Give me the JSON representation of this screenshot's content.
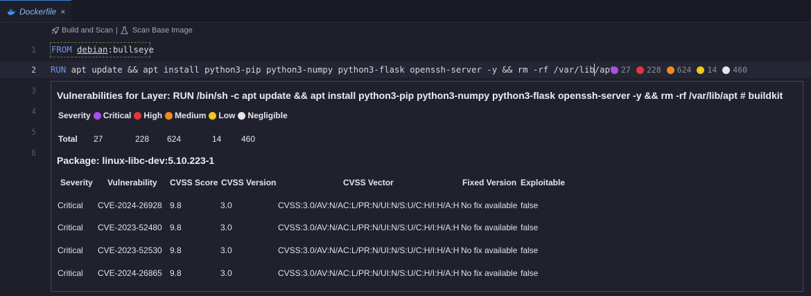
{
  "tab": {
    "label": "Dockerfile",
    "close": "×"
  },
  "codelens": {
    "build_scan": "Build and Scan",
    "separator": "|",
    "scan_base": "Scan Base Image"
  },
  "lines": {
    "n1": "1",
    "n2": "2",
    "n3": "3",
    "n4": "4",
    "n5": "5",
    "n6": "6",
    "l1_kw": "FROM",
    "l1_image": "debian",
    "l1_tag": ":bullseye",
    "l2_kw": "RUN",
    "l2_rest": " apt update && apt install python3-pip python3-numpy python3-flask openssh-server -y && rm -rf /var/lib/apt"
  },
  "inline_counts": {
    "critical": "27",
    "high": "228",
    "medium": "624",
    "low": "14",
    "negligible": "460"
  },
  "hover": {
    "title": "Vulnerabilities for Layer: RUN /bin/sh -c apt update && apt install python3-pip python3-numpy python3-flask openssh-server -y && rm -rf /var/lib/apt # buildkit",
    "legend": {
      "label": "Severity",
      "critical": "Critical",
      "high": "High",
      "medium": "Medium",
      "low": "Low",
      "negligible": "Negligible"
    },
    "totals": {
      "label": "Total",
      "critical": "27",
      "high": "228",
      "medium": "624",
      "low": "14",
      "negligible": "460"
    },
    "package": "Package: linux-libc-dev:5.10.223-1",
    "headers": {
      "severity": "Severity",
      "vulnerability": "Vulnerability",
      "cvss_score": "CVSS Score",
      "cvss_version": "CVSS Version",
      "cvss_vector": "CVSS Vector",
      "fixed_version": "Fixed Version",
      "exploitable": "Exploitable"
    },
    "rows": [
      {
        "severity": "Critical",
        "cve": "CVE-2024-26928",
        "score": "9.8",
        "version": "3.0",
        "vector": "CVSS:3.0/AV:N/AC:L/PR:N/UI:N/S:U/C:H/I:H/A:H",
        "fixed": "No fix available",
        "exploitable": "false"
      },
      {
        "severity": "Critical",
        "cve": "CVE-2023-52480",
        "score": "9.8",
        "version": "3.0",
        "vector": "CVSS:3.0/AV:N/AC:L/PR:N/UI:N/S:U/C:H/I:H/A:H",
        "fixed": "No fix available",
        "exploitable": "false"
      },
      {
        "severity": "Critical",
        "cve": "CVE-2023-52530",
        "score": "9.8",
        "version": "3.0",
        "vector": "CVSS:3.0/AV:N/AC:L/PR:N/UI:N/S:U/C:H/I:H/A:H",
        "fixed": "No fix available",
        "exploitable": "false"
      },
      {
        "severity": "Critical",
        "cve": "CVE-2024-26865",
        "score": "9.8",
        "version": "3.0",
        "vector": "CVSS:3.0/AV:N/AC:L/PR:N/UI:N/S:U/C:H/I:H/A:H",
        "fixed": "No fix available",
        "exploitable": "false"
      }
    ]
  },
  "colors": {
    "critical": "#a94ee8",
    "high": "#e8343a",
    "medium": "#f08c1e",
    "low": "#f3c81a",
    "negligible": "#e6e6e6",
    "keyword": "#6f95e6",
    "tab_accent": "#3c7fd8"
  },
  "icons": {
    "tab": "docker-whale-icon",
    "build": "rocket-icon",
    "scan": "flask-icon"
  }
}
